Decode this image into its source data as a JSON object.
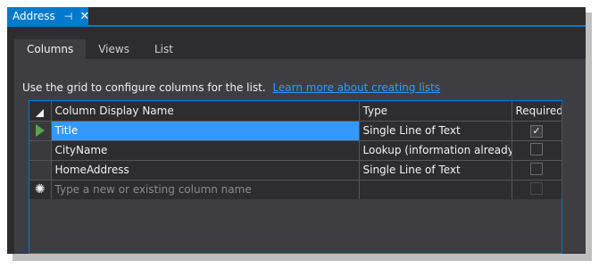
{
  "doc_tab": {
    "title": "Address",
    "pin_glyph": "⊣",
    "close_glyph": "✕"
  },
  "inner_tabs": [
    {
      "label": "Columns",
      "active": true
    },
    {
      "label": "Views",
      "active": false
    },
    {
      "label": "List",
      "active": false
    }
  ],
  "help": {
    "text": "Use the grid to configure columns for the list.",
    "link": "Learn more about creating lists"
  },
  "grid": {
    "columns": [
      "Column Display Name",
      "Type",
      "Required"
    ],
    "rows": [
      {
        "name": "Title",
        "type": "Single Line of Text",
        "required": true
      },
      {
        "name": "CityName",
        "type": "Lookup (information already on this site)",
        "required": false
      },
      {
        "name": "HomeAddress",
        "type": "Single Line of Text",
        "required": false
      }
    ],
    "new_row_placeholder": "Type a new or existing column name",
    "new_row_glyph": "✺"
  },
  "colors": {
    "accent": "#007acc",
    "selection": "#3399ff",
    "link": "#3399ff"
  }
}
